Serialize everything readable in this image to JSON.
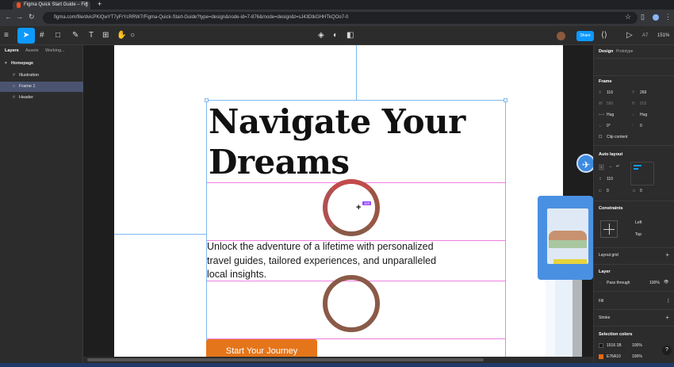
{
  "browser": {
    "tab_title": "Figma Quick Start Guide – Fig",
    "url": "figma.com/file/dvicPKiQwYT7yFrYcRRW7/Figma-Quick-Start-Guide?type=design&node-id=7-876&mode=design&t=sJ43DtkGHHTkQOo7-0"
  },
  "toolbar": {
    "share_label": "Share",
    "zoom": "151%",
    "user_initials": "A7"
  },
  "layers_panel": {
    "tabs": [
      "Layers",
      "Assets",
      "Working..."
    ],
    "page": "Homepage",
    "layers": [
      {
        "name": "Illustration",
        "selected": false
      },
      {
        "name": "Frame 1",
        "selected": true
      },
      {
        "name": "Header",
        "selected": false
      }
    ]
  },
  "canvas": {
    "heading": "Navigate Your Dreams",
    "paragraph": "Unlock the adventure of a lifetime with personalized travel guides, tailored experiences, and unparalleled local insights.",
    "cta": "Start Your Journey",
    "spacing_badge": "110"
  },
  "design_panel": {
    "tabs": [
      "Design",
      "Prototype"
    ],
    "frame_title": "Frame",
    "x": "116",
    "y": "269",
    "w": "580",
    "h": "503",
    "w_mode": "Hug",
    "h_mode": "Hug",
    "rotation": "0°",
    "radius": "0",
    "clip_content": "Clip content",
    "auto_layout_title": "Auto layout",
    "gap": "110",
    "pad_h": "0",
    "pad_v": "0",
    "constraints_title": "Constraints",
    "constraint_h": "Left",
    "constraint_v": "Top",
    "layout_grid": "Layout grid",
    "layer_title": "Layer",
    "blend": "Pass through",
    "opacity": "100%",
    "fill": "Fill",
    "stroke": "Stroke",
    "selection_colors_title": "Selection colors",
    "selection_colors": [
      {
        "hex": "1516 1B",
        "opacity": "100%",
        "swatch": "#15161b"
      },
      {
        "hex": "E76A10",
        "opacity": "100%",
        "swatch": "#e76a10"
      }
    ]
  }
}
